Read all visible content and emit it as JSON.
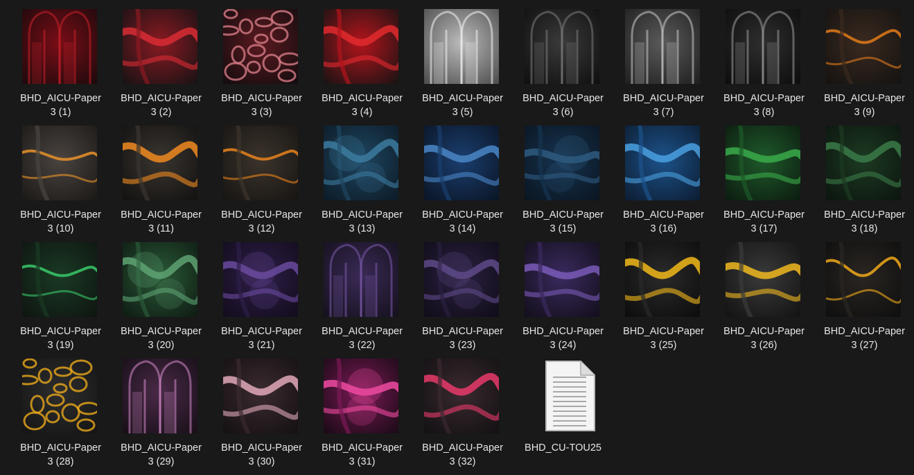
{
  "items": [
    {
      "name_line1": "BHD_AICU-Paper",
      "name_line2": "3 (1)",
      "theme": "red-gothic",
      "colors": [
        "#1a0a0c",
        "#7a0d16",
        "#c8202a"
      ]
    },
    {
      "name_line1": "BHD_AICU-Paper",
      "name_line2": "3 (2)",
      "theme": "red-marble",
      "colors": [
        "#151214",
        "#8a1a22",
        "#d92c34"
      ]
    },
    {
      "name_line1": "BHD_AICU-Paper",
      "name_line2": "3 (3)",
      "theme": "red-petals",
      "colors": [
        "#120c0e",
        "#5a1a20",
        "#d47a84"
      ]
    },
    {
      "name_line1": "BHD_AICU-Paper",
      "name_line2": "3 (4)",
      "theme": "red-marble",
      "colors": [
        "#161313",
        "#b3141c",
        "#e22a2e"
      ]
    },
    {
      "name_line1": "BHD_AICU-Paper",
      "name_line2": "3 (5)",
      "theme": "white-gothic",
      "colors": [
        "#4a4a4a",
        "#bcbcbc",
        "#f0f0f0"
      ]
    },
    {
      "name_line1": "BHD_AICU-Paper",
      "name_line2": "3 (6)",
      "theme": "dark-gothic",
      "colors": [
        "#0e0e0e",
        "#3a3a3a",
        "#7a7a7a"
      ]
    },
    {
      "name_line1": "BHD_AICU-Paper",
      "name_line2": "3 (7)",
      "theme": "grey-gothic",
      "colors": [
        "#1e1e1e",
        "#5a5a5a",
        "#c6c6c6"
      ]
    },
    {
      "name_line1": "BHD_AICU-Paper",
      "name_line2": "3 (8)",
      "theme": "dark-gothic",
      "colors": [
        "#0c0c0c",
        "#2e2e2e",
        "#9a9a9a"
      ]
    },
    {
      "name_line1": "BHD_AICU-Paper",
      "name_line2": "3 (9)",
      "theme": "orange-lava",
      "colors": [
        "#141210",
        "#3a2a20",
        "#e07a1a"
      ]
    },
    {
      "name_line1": "BHD_AICU-Paper",
      "name_line2": "3 (10)",
      "theme": "orange-lava",
      "colors": [
        "#1a1816",
        "#4a4440",
        "#e8922a"
      ]
    },
    {
      "name_line1": "BHD_AICU-Paper",
      "name_line2": "3 (11)",
      "theme": "orange-marble",
      "colors": [
        "#121110",
        "#3a3530",
        "#f08a20"
      ]
    },
    {
      "name_line1": "BHD_AICU-Paper",
      "name_line2": "3 (12)",
      "theme": "orange-lava",
      "colors": [
        "#161412",
        "#3c342c",
        "#e8821c"
      ]
    },
    {
      "name_line1": "BHD_AICU-Paper",
      "name_line2": "3 (13)",
      "theme": "blue-stone",
      "colors": [
        "#0c1a26",
        "#1e4660",
        "#3c7a9e"
      ]
    },
    {
      "name_line1": "BHD_AICU-Paper",
      "name_line2": "3 (14)",
      "theme": "blue-marble",
      "colors": [
        "#0a1424",
        "#1a3e6e",
        "#4a86c6"
      ]
    },
    {
      "name_line1": "BHD_AICU-Paper",
      "name_line2": "3 (15)",
      "theme": "blue-stone",
      "colors": [
        "#0a1420",
        "#163450",
        "#2e5a80"
      ]
    },
    {
      "name_line1": "BHD_AICU-Paper",
      "name_line2": "3 (16)",
      "theme": "blue-marble",
      "colors": [
        "#0c1c30",
        "#1c528a",
        "#4aa0e0"
      ]
    },
    {
      "name_line1": "BHD_AICU-Paper",
      "name_line2": "3 (17)",
      "theme": "green-marble",
      "colors": [
        "#0c1a10",
        "#1e5a2a",
        "#3aaa4a"
      ]
    },
    {
      "name_line1": "BHD_AICU-Paper",
      "name_line2": "3 (18)",
      "theme": "green-marble",
      "colors": [
        "#0c140e",
        "#1c3a22",
        "#3a7a48"
      ]
    },
    {
      "name_line1": "BHD_AICU-Paper",
      "name_line2": "3 (19)",
      "theme": "green-lava",
      "colors": [
        "#0e1410",
        "#1a3a24",
        "#3ac86a"
      ]
    },
    {
      "name_line1": "BHD_AICU-Paper",
      "name_line2": "3 (20)",
      "theme": "green-stone",
      "colors": [
        "#0e1a12",
        "#2a5a38",
        "#5ea272"
      ]
    },
    {
      "name_line1": "BHD_AICU-Paper",
      "name_line2": "3 (21)",
      "theme": "purple-smoke",
      "colors": [
        "#120c1c",
        "#2e1e48",
        "#6a4a9e"
      ]
    },
    {
      "name_line1": "BHD_AICU-Paper",
      "name_line2": "3 (22)",
      "theme": "purple-gothic",
      "colors": [
        "#14101c",
        "#3a2a56",
        "#7a5aaa"
      ]
    },
    {
      "name_line1": "BHD_AICU-Paper",
      "name_line2": "3 (23)",
      "theme": "purple-smoke",
      "colors": [
        "#100c18",
        "#2a2040",
        "#5e4a88"
      ]
    },
    {
      "name_line1": "BHD_AICU-Paper",
      "name_line2": "3 (24)",
      "theme": "purple-marble",
      "colors": [
        "#120e1a",
        "#3a2a5e",
        "#7a5ab8"
      ]
    },
    {
      "name_line1": "BHD_AICU-Paper",
      "name_line2": "3 (25)",
      "theme": "gold-marble",
      "colors": [
        "#0c0c0c",
        "#2a2a2a",
        "#f2b81a"
      ]
    },
    {
      "name_line1": "BHD_AICU-Paper",
      "name_line2": "3 (26)",
      "theme": "gold-marble",
      "colors": [
        "#121212",
        "#3a3a3a",
        "#f0b820"
      ]
    },
    {
      "name_line1": "BHD_AICU-Paper",
      "name_line2": "3 (27)",
      "theme": "gold-lava",
      "colors": [
        "#0e0e0e",
        "#2a2622",
        "#f0a81a"
      ]
    },
    {
      "name_line1": "BHD_AICU-Paper",
      "name_line2": "3 (28)",
      "theme": "gold-cells",
      "colors": [
        "#141414",
        "#2e2e2e",
        "#e8a81c"
      ]
    },
    {
      "name_line1": "BHD_AICU-Paper",
      "name_line2": "3 (29)",
      "theme": "pink-hall",
      "colors": [
        "#160e16",
        "#4a2a48",
        "#d28ac8"
      ]
    },
    {
      "name_line1": "BHD_AICU-Paper",
      "name_line2": "3 (30)",
      "theme": "pink-marble",
      "colors": [
        "#141012",
        "#3a2a30",
        "#e0a8b8"
      ]
    },
    {
      "name_line1": "BHD_AICU-Paper",
      "name_line2": "3 (31)",
      "theme": "magenta-nebula",
      "colors": [
        "#180a14",
        "#7a1a56",
        "#ee4aa0"
      ]
    },
    {
      "name_line1": "BHD_AICU-Paper",
      "name_line2": "3 (32)",
      "theme": "pink-marble",
      "colors": [
        "#121012",
        "#3a2a30",
        "#e83a6a"
      ]
    },
    {
      "name_line1": "BHD_CU-TOU25",
      "name_line2": "",
      "theme": "text-document",
      "icon": "text-document-icon",
      "colors": [
        "#ffffff",
        "#e8e8e8",
        "#9a9a9a"
      ]
    }
  ]
}
